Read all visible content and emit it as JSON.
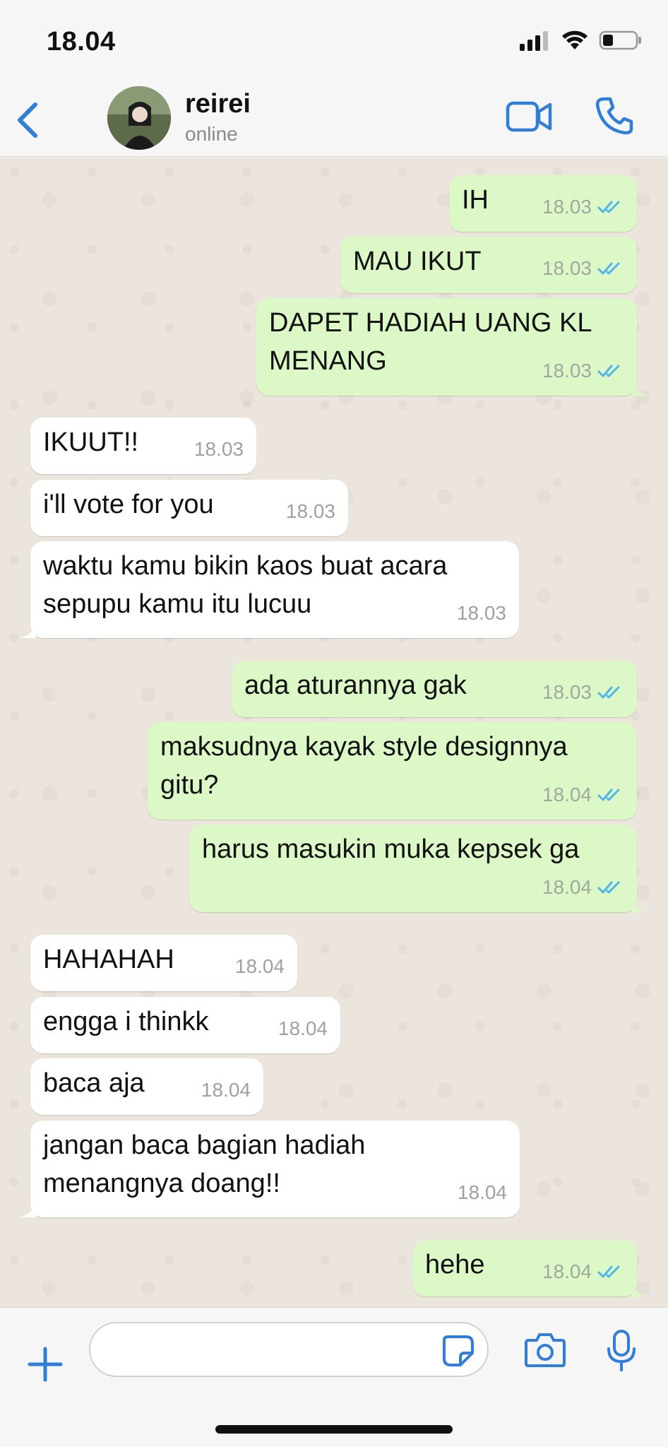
{
  "status_bar": {
    "time": "18.04"
  },
  "header": {
    "back_icon": "chevron-left-icon",
    "contact_name": "reirei",
    "contact_status": "online",
    "accent": "#2f7ed8"
  },
  "messages": [
    {
      "dir": "out",
      "text": "IH",
      "time": "18.03",
      "read": true
    },
    {
      "dir": "out",
      "text": "MAU IKUT",
      "time": "18.03",
      "read": true
    },
    {
      "dir": "out",
      "text": "DAPET HADIAH UANG KL MENANG",
      "time": "18.03",
      "read": true
    },
    {
      "dir": "in",
      "text": "IKUUT!!",
      "time": "18.03"
    },
    {
      "dir": "in",
      "text": "i'll vote for you",
      "time": "18.03"
    },
    {
      "dir": "in",
      "text": "waktu kamu bikin kaos buat acara sepupu kamu itu lucuu",
      "time": "18.03"
    },
    {
      "dir": "out",
      "text": "ada aturannya gak",
      "time": "18.03",
      "read": true
    },
    {
      "dir": "out",
      "text": "maksudnya kayak style designnya gitu?",
      "time": "18.04",
      "read": true
    },
    {
      "dir": "out",
      "text": "harus masukin muka kepsek ga",
      "time": "18.04",
      "read": true
    },
    {
      "dir": "in",
      "text": "HAHAHAH",
      "time": "18.04"
    },
    {
      "dir": "in",
      "text": "engga i thinkk",
      "time": "18.04"
    },
    {
      "dir": "in",
      "text": "baca aja",
      "time": "18.04"
    },
    {
      "dir": "in",
      "text": "jangan baca bagian hadiah menangnya doang!!",
      "time": "18.04"
    },
    {
      "dir": "out",
      "text": "hehe",
      "time": "18.04",
      "read": true
    }
  ],
  "input_bar": {
    "placeholder": ""
  },
  "colors": {
    "outgoing_bubble": "#dcf8c6",
    "incoming_bubble": "#ffffff",
    "read_tick": "#4fb6ec",
    "chat_bg": "#ece5dd"
  }
}
